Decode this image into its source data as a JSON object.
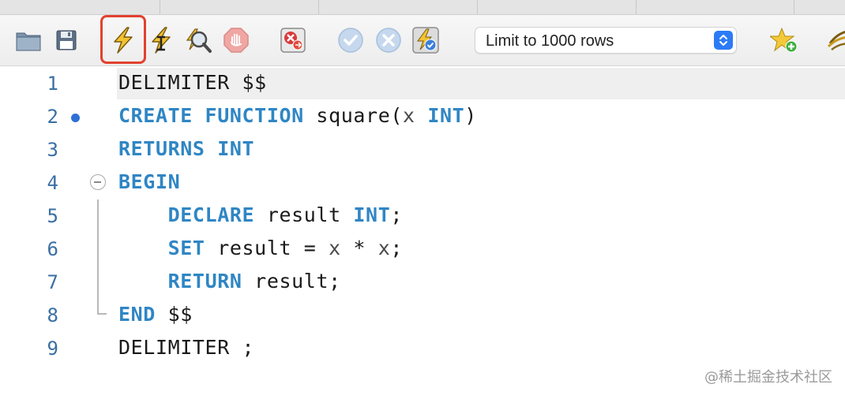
{
  "toolbar": {
    "icons": [
      "open-folder-icon",
      "save-icon",
      "execute-icon",
      "execute-current-statement-icon",
      "explain-icon",
      "stop-icon",
      "toggle-continue-on-error-icon",
      "commit-icon",
      "rollback-icon",
      "autocommit-icon",
      "add-snippet-icon",
      "beautify-icon"
    ],
    "limit_select": {
      "value": "Limit to 1000 rows"
    },
    "highlight_color": "#e2412f"
  },
  "editor": {
    "keyword_color": "#2f86c4",
    "line_number_color": "#3a6fa3",
    "current_line": 1,
    "lines": [
      {
        "number": "1",
        "segments": [
          {
            "t": "DELIMITER $$",
            "k": "plain"
          }
        ]
      },
      {
        "number": "2",
        "segments": [
          {
            "t": "CREATE FUNCTION",
            "k": "kw"
          },
          {
            "t": " square(",
            "k": "plain"
          },
          {
            "t": "x",
            "k": "ident"
          },
          {
            "t": " ",
            "k": "plain"
          },
          {
            "t": "INT",
            "k": "kw"
          },
          {
            "t": ")",
            "k": "plain"
          }
        ]
      },
      {
        "number": "3",
        "segments": [
          {
            "t": "RETURNS INT",
            "k": "kw"
          }
        ]
      },
      {
        "number": "4",
        "segments": [
          {
            "t": "BEGIN",
            "k": "kw"
          }
        ]
      },
      {
        "number": "5",
        "segments": [
          {
            "t": "    ",
            "k": "plain"
          },
          {
            "t": "DECLARE",
            "k": "kw"
          },
          {
            "t": " result ",
            "k": "plain"
          },
          {
            "t": "INT",
            "k": "kw"
          },
          {
            "t": ";",
            "k": "plain"
          }
        ]
      },
      {
        "number": "6",
        "segments": [
          {
            "t": "    ",
            "k": "plain"
          },
          {
            "t": "SET",
            "k": "kw"
          },
          {
            "t": " result = ",
            "k": "plain"
          },
          {
            "t": "x",
            "k": "ident"
          },
          {
            "t": " * ",
            "k": "plain"
          },
          {
            "t": "x",
            "k": "ident"
          },
          {
            "t": ";",
            "k": "plain"
          }
        ]
      },
      {
        "number": "7",
        "segments": [
          {
            "t": "    ",
            "k": "plain"
          },
          {
            "t": "RETURN",
            "k": "kw"
          },
          {
            "t": " result;",
            "k": "plain"
          }
        ]
      },
      {
        "number": "8",
        "segments": [
          {
            "t": "END",
            "k": "kw"
          },
          {
            "t": " $$",
            "k": "plain"
          }
        ]
      },
      {
        "number": "9",
        "segments": [
          {
            "t": "DELIMITER ;",
            "k": "plain"
          }
        ]
      }
    ]
  },
  "watermark": "@稀土掘金技术社区"
}
